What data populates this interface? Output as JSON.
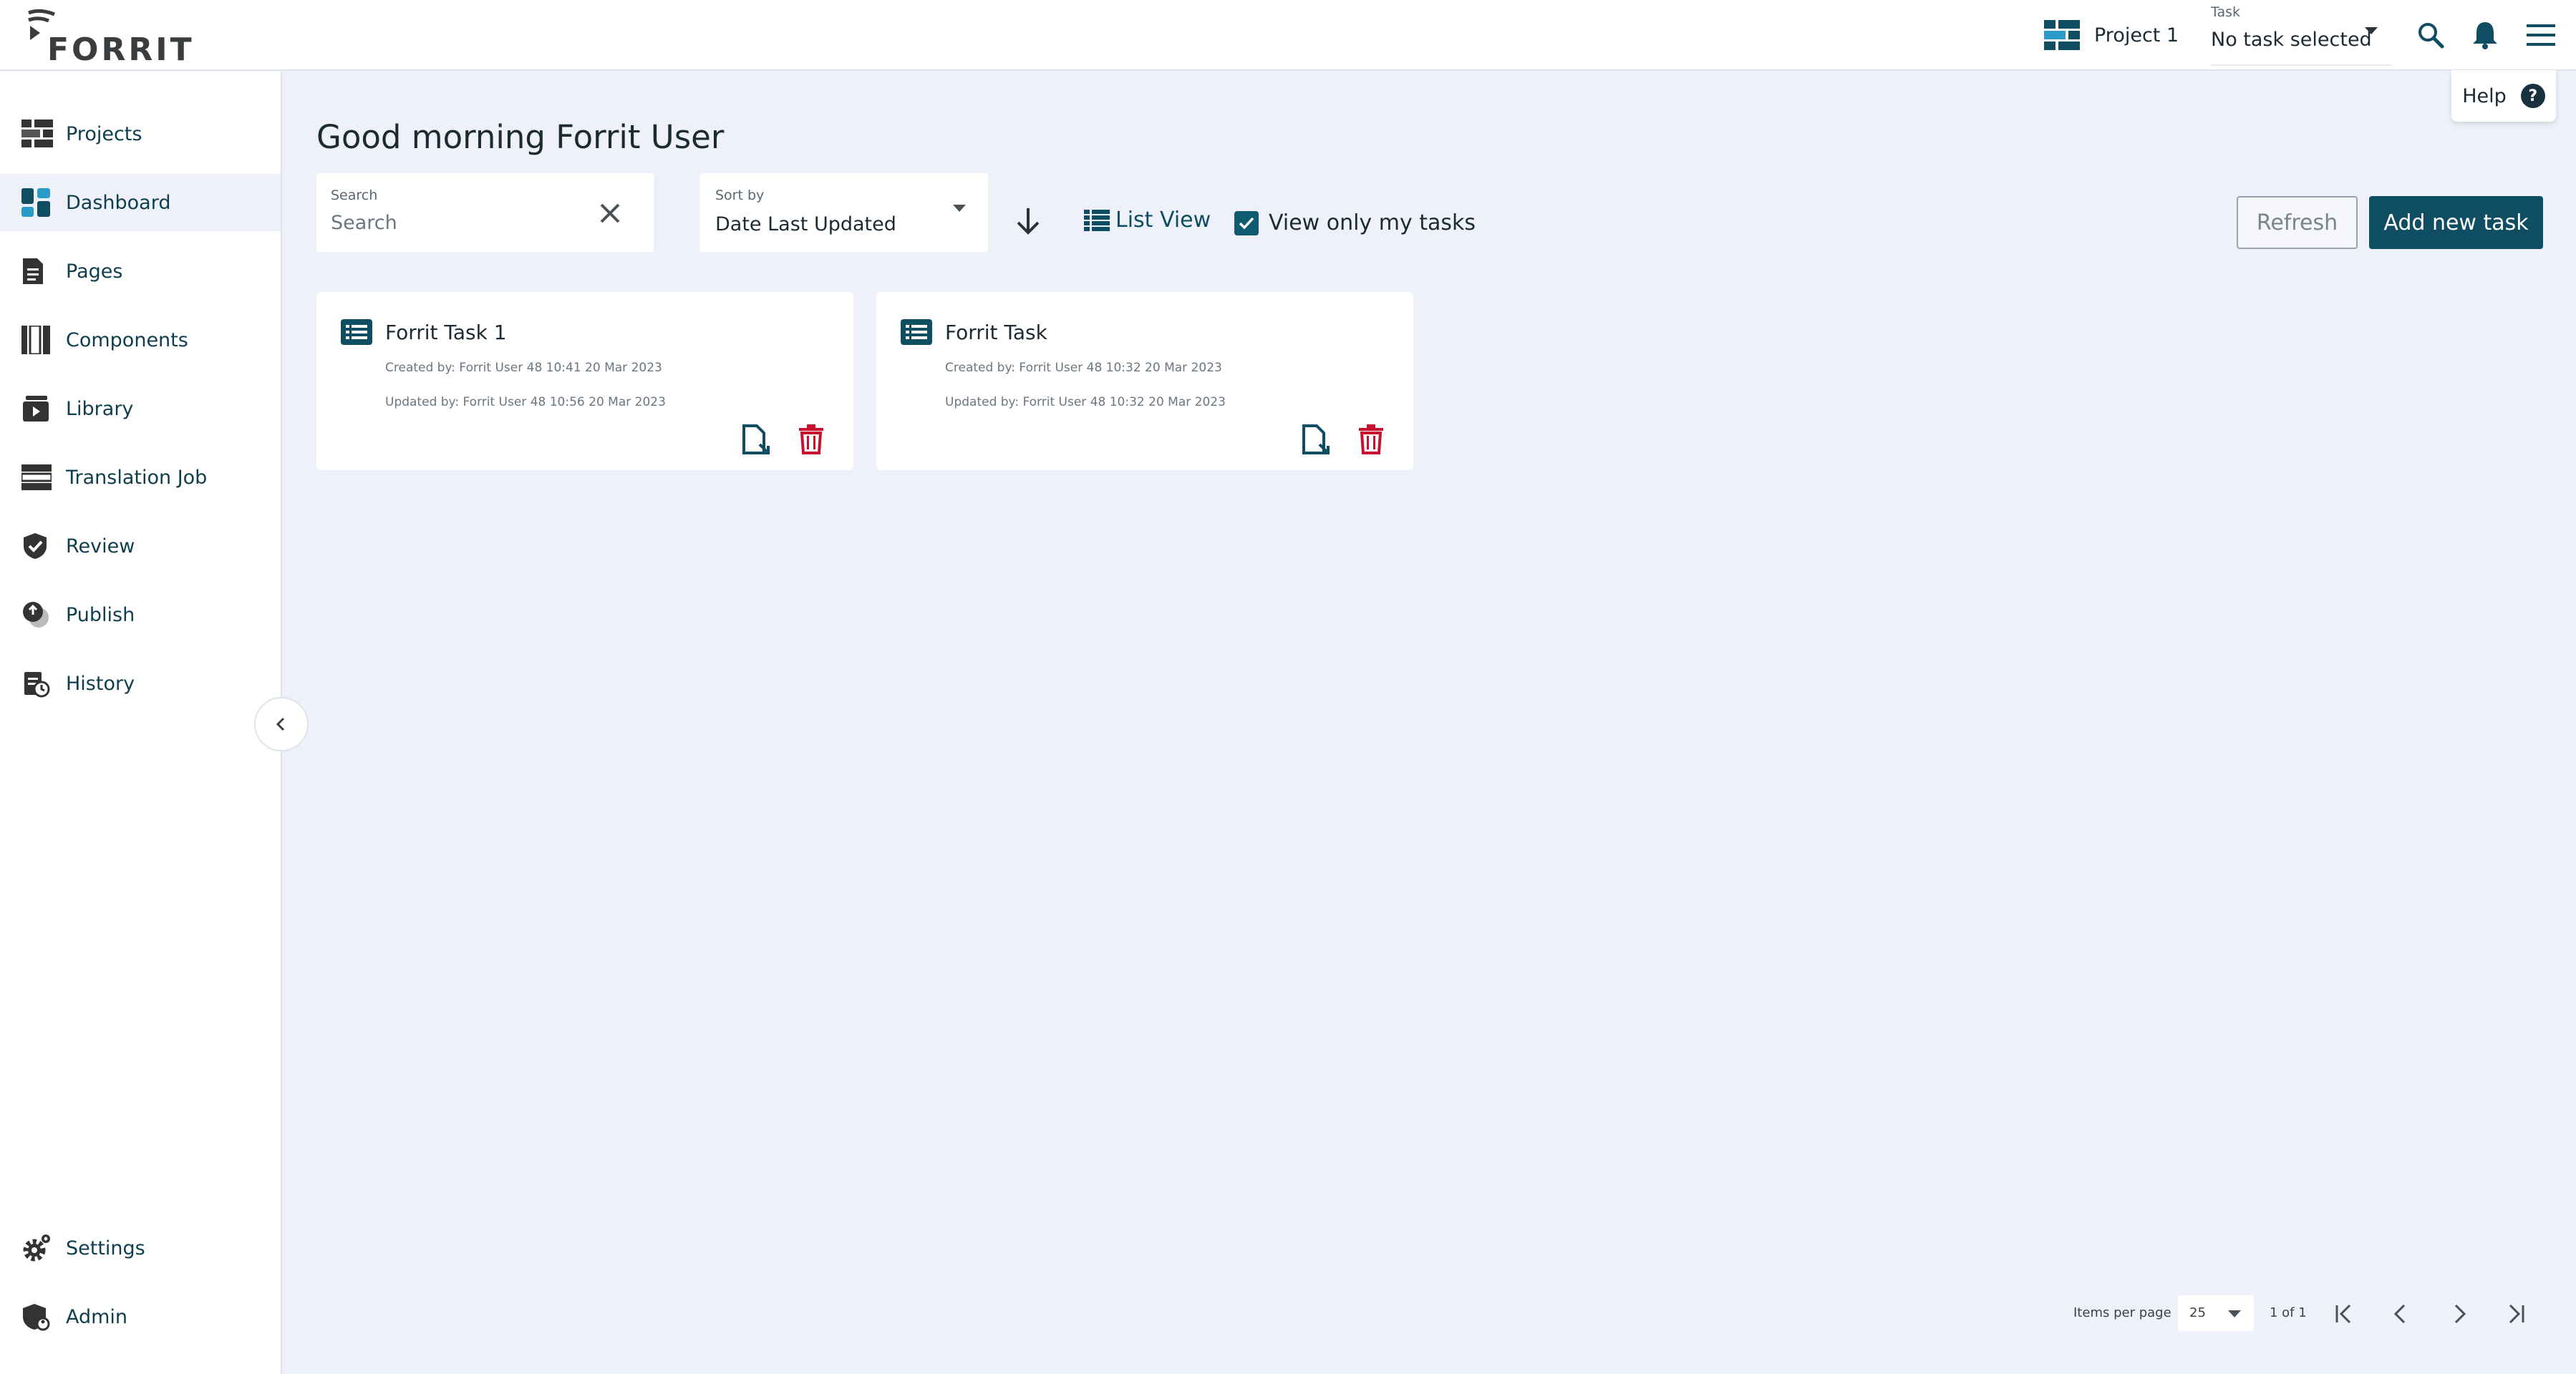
{
  "app": {
    "logo_text": "FORRIT"
  },
  "header": {
    "project_label": "Project 1",
    "task_label": "Task",
    "task_value": "No task selected"
  },
  "help": {
    "label": "Help",
    "mark": "?"
  },
  "sidebar": {
    "items": [
      {
        "label": "Projects",
        "icon": "projects-icon"
      },
      {
        "label": "Dashboard",
        "icon": "dashboard-icon",
        "active": true
      },
      {
        "label": "Pages",
        "icon": "page-icon"
      },
      {
        "label": "Components",
        "icon": "components-icon"
      },
      {
        "label": "Library",
        "icon": "library-icon"
      },
      {
        "label": "Translation Job",
        "icon": "translation-icon"
      },
      {
        "label": "Review",
        "icon": "review-icon"
      },
      {
        "label": "Publish",
        "icon": "publish-icon"
      },
      {
        "label": "History",
        "icon": "history-icon"
      }
    ],
    "bottom": [
      {
        "label": "Settings",
        "icon": "gear-icon"
      },
      {
        "label": "Admin",
        "icon": "admin-icon"
      }
    ]
  },
  "main": {
    "greeting": "Good morning Forrit User",
    "search": {
      "label": "Search",
      "placeholder": "Search",
      "value": ""
    },
    "sort": {
      "label": "Sort by",
      "value": "Date Last Updated"
    },
    "list_view_label": "List View",
    "view_only_mine_label": "View only my tasks",
    "view_only_mine_checked": true,
    "refresh_label": "Refresh",
    "add_label": "Add new task"
  },
  "tasks": [
    {
      "title": "Forrit Task 1",
      "created": "Created by: Forrit User 48 10:41 20 Mar 2023",
      "updated": "Updated by: Forrit User 48 10:56 20 Mar 2023"
    },
    {
      "title": "Forrit Task",
      "created": "Created by: Forrit User 48 10:32 20 Mar 2023",
      "updated": "Updated by: Forrit User 48 10:32 20 Mar 2023"
    }
  ],
  "pagination": {
    "items_per_page_label": "Items per page",
    "items_per_page": "25",
    "page_info": "1 of 1"
  },
  "colors": {
    "accent": "#0e4d62",
    "delete": "#c8102e",
    "background": "#eef1f9"
  }
}
